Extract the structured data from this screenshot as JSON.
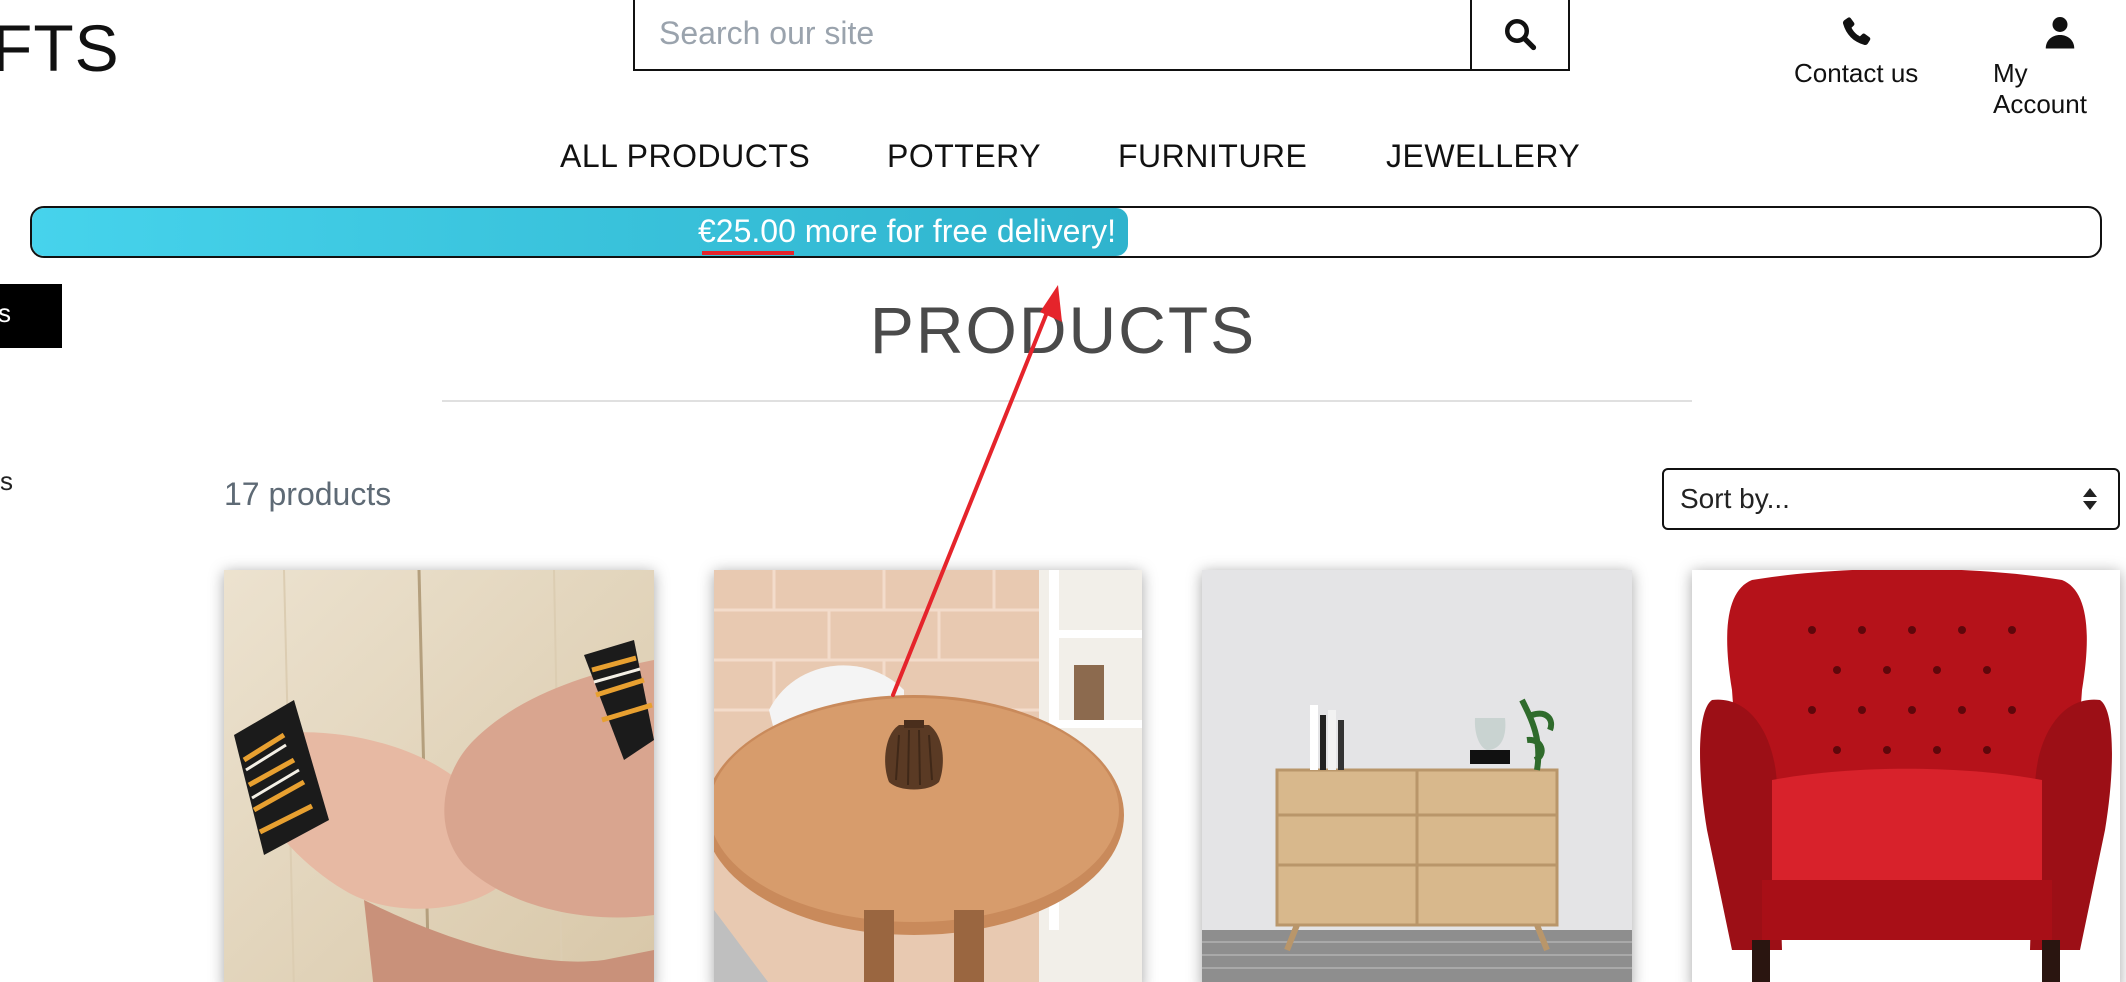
{
  "header": {
    "logo_text": "FTS",
    "search": {
      "placeholder": "Search our site",
      "value": ""
    },
    "contact_label": "Contact us",
    "account_label": "My Account"
  },
  "nav": {
    "items": [
      {
        "label": "ALL PRODUCTS"
      },
      {
        "label": "POTTERY"
      },
      {
        "label": "FURNITURE"
      },
      {
        "label": "JEWELLERY"
      }
    ]
  },
  "delivery": {
    "amount": "€25.00",
    "message": " more for free delivery!",
    "progress_percent": 53
  },
  "sidebar": {
    "button_label": "s",
    "item_label": "s"
  },
  "main": {
    "title": "PRODUCTS",
    "count_text": "17 products",
    "sort_label": "Sort by..."
  },
  "products": [
    {
      "image": "bracelets-on-wrists"
    },
    {
      "image": "vase-on-round-table"
    },
    {
      "image": "oak-chest-of-drawers"
    },
    {
      "image": "red-leather-wingback-chair"
    }
  ],
  "annotation": {
    "color": "#e5242b"
  },
  "colors": {
    "accent_cyan": "#46d3ec",
    "text_dark": "#111111",
    "muted": "#5e6a75"
  }
}
